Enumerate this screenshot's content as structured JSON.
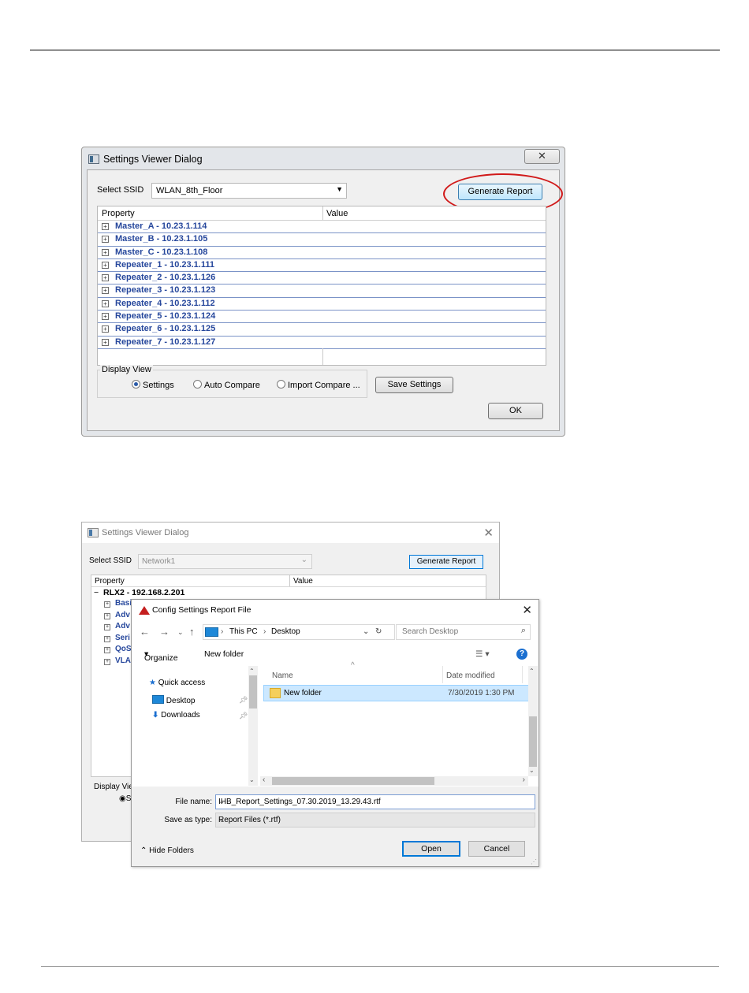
{
  "dialog1": {
    "title": "Settings Viewer Dialog",
    "close_glyph": "✕",
    "ssid_label": "Select SSID",
    "ssid_value": "WLAN_8th_Floor",
    "generate_label": "Generate Report",
    "columns": [
      "Property",
      "Value"
    ],
    "rows": [
      "Master_A - 10.23.1.114",
      "Master_B - 10.23.1.105",
      "Master_C - 10.23.1.108",
      "Repeater_1 - 10.23.1.111",
      "Repeater_2 - 10.23.1.126",
      "Repeater_3 - 10.23.1.123",
      "Repeater_4 - 10.23.1.112",
      "Repeater_5 - 10.23.1.124",
      "Repeater_6 - 10.23.1.125",
      "Repeater_7 - 10.23.1.127"
    ],
    "display_view_label": "Display View",
    "radio_settings": "Settings",
    "radio_auto": "Auto Compare",
    "radio_import": "Import Compare ...",
    "save_label": "Save Settings",
    "ok_label": "OK",
    "highlight_color": "#d11a1a"
  },
  "dialog2": {
    "title": "Settings Viewer Dialog",
    "ssid_label": "Select SSID",
    "ssid_value": "Network1",
    "generate_label": "Generate Report",
    "columns": [
      "Property",
      "Value"
    ],
    "root_row": "RLX2  - 192.168.2.201",
    "sub_rows": [
      "Basi",
      "Adv",
      "Adv",
      "Seri",
      "QoS",
      "VLA"
    ],
    "display_view_label": "Display View",
    "radio_partial": "S"
  },
  "file_dialog": {
    "title": "Config Settings Report File",
    "path": [
      "This PC",
      "Desktop"
    ],
    "search_placeholder": "Search Desktop",
    "organize_label": "Organize",
    "new_folder_label": "New folder",
    "nav_items": [
      "Quick access",
      "Desktop",
      "Downloads"
    ],
    "col_name": "Name",
    "col_date": "Date modified",
    "items": [
      {
        "name": "New folder",
        "date": "7/30/2019 1:30 PM"
      }
    ],
    "file_name_label": "File name:",
    "file_name_value": "IHB_Report_Settings_07.30.2019_13.29.43.rtf",
    "save_type_label": "Save as type:",
    "save_type_value": "Report Files (*.rtf)",
    "hide_folders_label": "Hide Folders",
    "open_label": "Open",
    "cancel_label": "Cancel"
  }
}
